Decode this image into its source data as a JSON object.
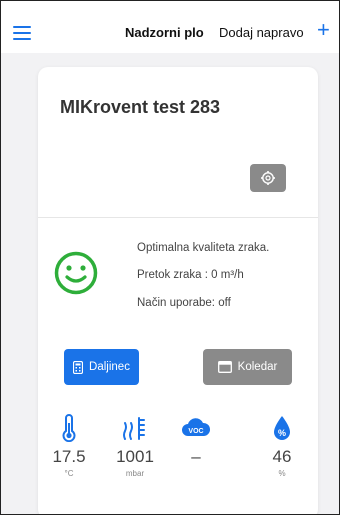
{
  "header": {
    "title": "Nadzorni plo",
    "add_device_label": "Dodaj napravo",
    "add_icon": "+"
  },
  "device": {
    "name": "MIKrovent test 283"
  },
  "status": {
    "quality": "Optimalna kvaliteta zraka.",
    "airflow": "Pretok zraka :  0 m³/h",
    "mode": "Način uporabe:  off"
  },
  "buttons": {
    "remote_label": "Daljinec",
    "calendar_label": "Koledar"
  },
  "sensors": [
    {
      "icon": "thermometer-icon",
      "value": "17.5",
      "unit": "°C"
    },
    {
      "icon": "pressure-icon",
      "value": "1001",
      "unit": "mbar"
    },
    {
      "icon": "voc-icon",
      "value": "–",
      "unit": "",
      "badge": "VOC"
    },
    {
      "icon": "humidity-icon",
      "value": "46",
      "unit": "%",
      "badge": "%"
    }
  ],
  "colors": {
    "accent": "#1a73e8",
    "good": "#2eae3a",
    "muted_button": "#8a8a8a"
  }
}
